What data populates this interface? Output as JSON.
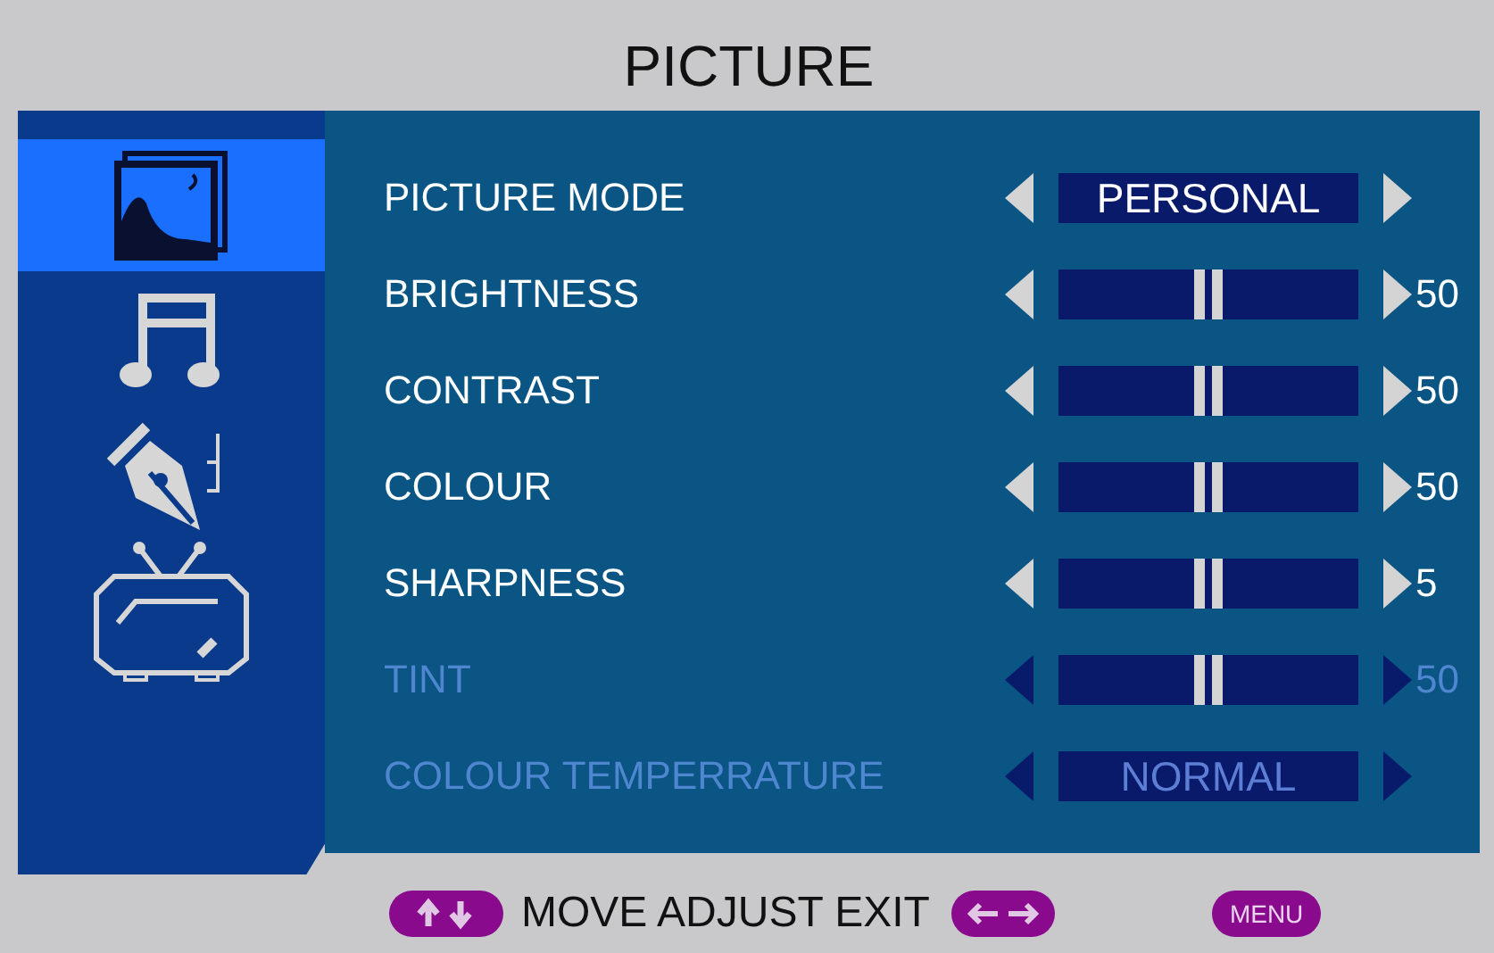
{
  "title": "PICTURE",
  "sidebar": {
    "items": [
      {
        "kind": "picture",
        "selected": true
      },
      {
        "kind": "sound",
        "selected": false
      },
      {
        "kind": "setup",
        "selected": false
      },
      {
        "kind": "tv",
        "selected": false
      }
    ]
  },
  "rows": [
    {
      "kind": "option",
      "label": "PICTURE MODE",
      "value": "PERSONAL",
      "disabled": false
    },
    {
      "kind": "slider",
      "label": "BRIGHTNESS",
      "level": 0.5,
      "reading": "50",
      "disabled": false
    },
    {
      "kind": "slider",
      "label": "CONTRAST",
      "level": 0.5,
      "reading": "50",
      "disabled": false
    },
    {
      "kind": "slider",
      "label": "COLOUR",
      "level": 0.5,
      "reading": "50",
      "disabled": false
    },
    {
      "kind": "slider",
      "label": "SHARPNESS",
      "level": 0.5,
      "reading": "5",
      "disabled": false
    },
    {
      "kind": "slider",
      "label": "TINT",
      "level": 0.5,
      "reading": "50",
      "disabled": true
    },
    {
      "kind": "option",
      "label": "COLOUR TEMPERRATURE",
      "value": "NORMAL",
      "disabled": true
    }
  ],
  "footer": {
    "hint": "MOVE ADJUST EXIT",
    "menu_key": "MENU"
  }
}
